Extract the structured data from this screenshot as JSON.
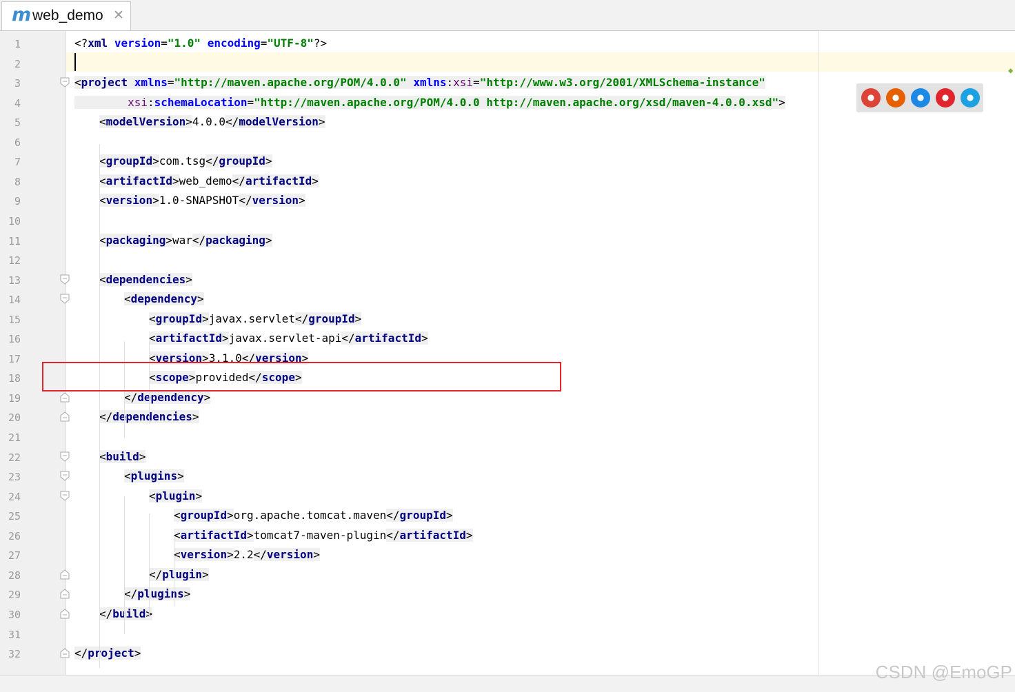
{
  "tab": {
    "icon": "maven-m-icon",
    "icon_glyph": "m",
    "title": "web_demo",
    "close_glyph": "✕"
  },
  "editor": {
    "lines": [
      {
        "n": "1",
        "text": ""
      },
      {
        "n": "2",
        "text": ""
      },
      {
        "n": "3",
        "text": ""
      },
      {
        "n": "4",
        "text": ""
      },
      {
        "n": "5",
        "text": ""
      },
      {
        "n": "6",
        "text": ""
      },
      {
        "n": "7",
        "text": ""
      },
      {
        "n": "8",
        "text": ""
      },
      {
        "n": "9",
        "text": ""
      },
      {
        "n": "10",
        "text": ""
      },
      {
        "n": "11",
        "text": ""
      },
      {
        "n": "12",
        "text": ""
      },
      {
        "n": "13",
        "text": ""
      },
      {
        "n": "14",
        "text": ""
      },
      {
        "n": "15",
        "text": ""
      },
      {
        "n": "16",
        "text": ""
      },
      {
        "n": "17",
        "text": ""
      },
      {
        "n": "18",
        "text": ""
      },
      {
        "n": "19",
        "text": ""
      },
      {
        "n": "20",
        "text": ""
      },
      {
        "n": "21",
        "text": ""
      },
      {
        "n": "22",
        "text": ""
      },
      {
        "n": "23",
        "text": ""
      },
      {
        "n": "24",
        "text": ""
      },
      {
        "n": "25",
        "text": ""
      },
      {
        "n": "26",
        "text": ""
      },
      {
        "n": "27",
        "text": ""
      },
      {
        "n": "28",
        "text": ""
      },
      {
        "n": "29",
        "text": ""
      },
      {
        "n": "30",
        "text": ""
      },
      {
        "n": "31",
        "text": ""
      },
      {
        "n": "32",
        "text": ""
      }
    ],
    "code": {
      "l1": [
        "<?",
        "xml",
        " ",
        "version",
        "=",
        "\"1.0\"",
        " ",
        "encoding",
        "=",
        "\"UTF-8\"",
        "?>"
      ],
      "l3": [
        "<",
        "project",
        " ",
        "xmlns",
        "=",
        "\"http://maven.apache.org/POM/4.0.0\"",
        " ",
        "xmlns",
        ":",
        "xsi",
        "=",
        "\"http://www.w3.org/2001/XMLSchema-instance\""
      ],
      "l4": [
        "xsi",
        ":",
        "schemaLocation",
        "=",
        "\"http://maven.apache.org/POM/4.0.0 http://maven.apache.org/xsd/maven-4.0.0.xsd\"",
        ">"
      ],
      "modelVersion": {
        "tag": "modelVersion",
        "value": "4.0.0"
      },
      "groupId": {
        "tag": "groupId",
        "value": "com.tsg"
      },
      "artifactId": {
        "tag": "artifactId",
        "value": "web_demo"
      },
      "version": {
        "tag": "version",
        "value": "1.0-SNAPSHOT"
      },
      "packaging": {
        "tag": "packaging",
        "value": "war"
      },
      "dependencies": "dependencies",
      "dependency": "dependency",
      "dep_groupId": {
        "tag": "groupId",
        "value": "javax.servlet"
      },
      "dep_artifactId": {
        "tag": "artifactId",
        "value": "javax.servlet-api"
      },
      "dep_version": {
        "tag": "version",
        "value": "3.1.0"
      },
      "dep_scope": {
        "tag": "scope",
        "value": "provided"
      },
      "build": "build",
      "plugins": "plugins",
      "plugin": "plugin",
      "pl_groupId": {
        "tag": "groupId",
        "value": "org.apache.tomcat.maven"
      },
      "pl_artifactId": {
        "tag": "artifactId",
        "value": "tomcat7-maven-plugin"
      },
      "pl_version": {
        "tag": "version",
        "value": "2.2"
      },
      "project": "project"
    }
  },
  "browsers": [
    {
      "name": "chrome-icon",
      "color": "#db4437"
    },
    {
      "name": "firefox-icon",
      "color": "#e66000"
    },
    {
      "name": "safari-icon",
      "color": "#1e88e5"
    },
    {
      "name": "opera-icon",
      "color": "#e0262c"
    },
    {
      "name": "ie-icon",
      "color": "#1ea1e0"
    }
  ],
  "highlight_color": "#e0262c",
  "watermark": "CSDN @EmoGP"
}
